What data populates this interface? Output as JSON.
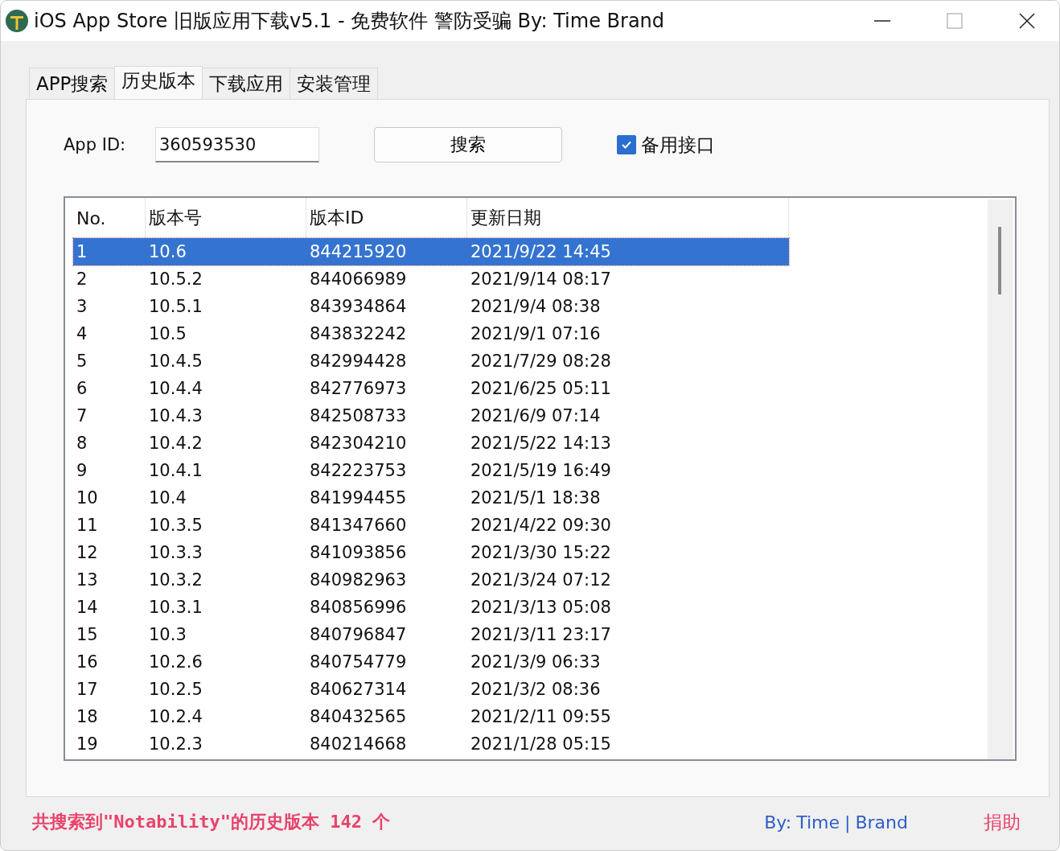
{
  "window": {
    "title": "iOS App Store 旧版应用下载v5.1 - 免费软件 警防受骗 By: Time Brand"
  },
  "tabs": [
    {
      "label": "APP搜索",
      "selected": false
    },
    {
      "label": "历史版本",
      "selected": true
    },
    {
      "label": "下载应用",
      "selected": false
    },
    {
      "label": "安装管理",
      "selected": false
    }
  ],
  "form": {
    "app_id_label": "App ID:",
    "app_id_value": "360593530",
    "search_button": "搜索",
    "backup_api": {
      "label": "备用接口",
      "checked": true
    }
  },
  "table": {
    "columns": [
      "No.",
      "版本号",
      "版本ID",
      "更新日期"
    ],
    "rows": [
      {
        "cells": [
          "1",
          "10.6",
          "844215920",
          "2021/9/22 14:45"
        ],
        "selected": true
      },
      {
        "cells": [
          "2",
          "10.5.2",
          "844066989",
          "2021/9/14 08:17"
        ],
        "selected": false
      },
      {
        "cells": [
          "3",
          "10.5.1",
          "843934864",
          "2021/9/4 08:38"
        ],
        "selected": false
      },
      {
        "cells": [
          "4",
          "10.5",
          "843832242",
          "2021/9/1 07:16"
        ],
        "selected": false
      },
      {
        "cells": [
          "5",
          "10.4.5",
          "842994428",
          "2021/7/29 08:28"
        ],
        "selected": false
      },
      {
        "cells": [
          "6",
          "10.4.4",
          "842776973",
          "2021/6/25 05:11"
        ],
        "selected": false
      },
      {
        "cells": [
          "7",
          "10.4.3",
          "842508733",
          "2021/6/9 07:14"
        ],
        "selected": false
      },
      {
        "cells": [
          "8",
          "10.4.2",
          "842304210",
          "2021/5/22 14:13"
        ],
        "selected": false
      },
      {
        "cells": [
          "9",
          "10.4.1",
          "842223753",
          "2021/5/19 16:49"
        ],
        "selected": false
      },
      {
        "cells": [
          "10",
          "10.4",
          "841994455",
          "2021/5/1 18:38"
        ],
        "selected": false
      },
      {
        "cells": [
          "11",
          "10.3.5",
          "841347660",
          "2021/4/22 09:30"
        ],
        "selected": false
      },
      {
        "cells": [
          "12",
          "10.3.3",
          "841093856",
          "2021/3/30 15:22"
        ],
        "selected": false
      },
      {
        "cells": [
          "13",
          "10.3.2",
          "840982963",
          "2021/3/24 07:12"
        ],
        "selected": false
      },
      {
        "cells": [
          "14",
          "10.3.1",
          "840856996",
          "2021/3/13 05:08"
        ],
        "selected": false
      },
      {
        "cells": [
          "15",
          "10.3",
          "840796847",
          "2021/3/11 23:17"
        ],
        "selected": false
      },
      {
        "cells": [
          "16",
          "10.2.6",
          "840754779",
          "2021/3/9 06:33"
        ],
        "selected": false
      },
      {
        "cells": [
          "17",
          "10.2.5",
          "840627314",
          "2021/3/2 08:36"
        ],
        "selected": false
      },
      {
        "cells": [
          "18",
          "10.2.4",
          "840432565",
          "2021/2/11 09:55"
        ],
        "selected": false
      },
      {
        "cells": [
          "19",
          "10.2.3",
          "840214668",
          "2021/1/28 05:15"
        ],
        "selected": false
      }
    ]
  },
  "status_bar": {
    "message": "共搜索到\"Notability\"的历史版本 142 个",
    "by_label": "By:",
    "author_first": "Time",
    "separator": "|",
    "author_last": "Brand",
    "donate_link": "捐助"
  }
}
